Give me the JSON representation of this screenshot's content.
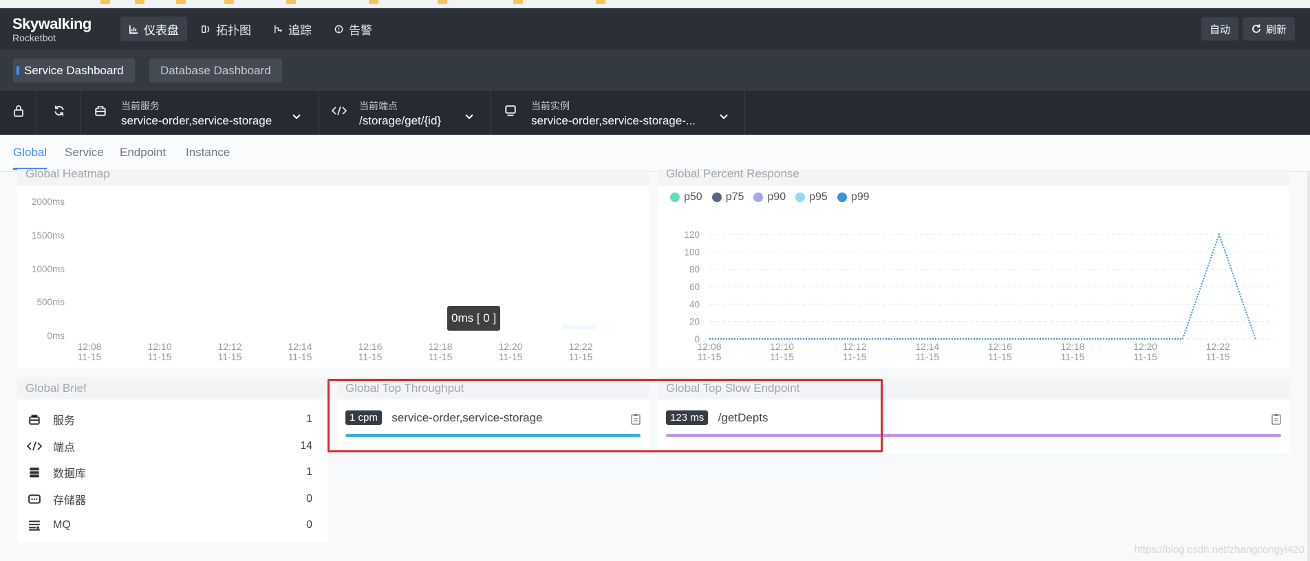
{
  "app": {
    "brand": "Skywalking",
    "sub": "Rocketbot"
  },
  "nav": {
    "items": [
      {
        "label": "仪表盘",
        "icon": "chart-icon"
      },
      {
        "label": "拓扑图",
        "icon": "topology-icon"
      },
      {
        "label": "追踪",
        "icon": "trace-icon"
      },
      {
        "label": "告警",
        "icon": "alarm-icon"
      }
    ],
    "auto_label": "自动",
    "refresh_label": "刷新"
  },
  "dashboards": {
    "active": "Service Dashboard",
    "inactive": "Database Dashboard"
  },
  "selectors": {
    "service": {
      "label": "当前服务",
      "value": "service-order,service-storage"
    },
    "endpoint": {
      "label": "当前端点",
      "value": "/storage/get/{id}"
    },
    "instance": {
      "label": "当前实例",
      "value": "service-order,service-storage-..."
    }
  },
  "tabs": [
    "Global",
    "Service",
    "Endpoint",
    "Instance"
  ],
  "heatmap": {
    "title": "Global Heatmap",
    "y_ticks": [
      "2000ms",
      "1500ms",
      "1000ms",
      "500ms",
      "0ms"
    ],
    "x_ticks": [
      "12:08",
      "12:10",
      "12:12",
      "12:14",
      "12:16",
      "12:18",
      "12:20",
      "12:22"
    ],
    "date": "11-15",
    "tooltip": "0ms [ 0 ]"
  },
  "percent": {
    "title": "Global Percent Response",
    "legend": [
      {
        "name": "p50",
        "color": "#5fe0b9"
      },
      {
        "name": "p75",
        "color": "#5a6683"
      },
      {
        "name": "p90",
        "color": "#a3a9e6"
      },
      {
        "name": "p95",
        "color": "#90dcec"
      },
      {
        "name": "p99",
        "color": "#3d8fe0"
      }
    ]
  },
  "chart_data": {
    "type": "line",
    "title": "Global Percent Response",
    "x": [
      "12:08",
      "12:10",
      "12:12",
      "12:14",
      "12:16",
      "12:18",
      "12:20",
      "12:22"
    ],
    "x_sub": "11-15",
    "ylim": [
      0,
      120
    ],
    "y_ticks": [
      0,
      20,
      40,
      60,
      80,
      100,
      120
    ],
    "series": [
      {
        "name": "p99",
        "color": "#3d8fe0",
        "points": [
          [
            0,
            0
          ],
          [
            13,
            0
          ],
          [
            14,
            120
          ],
          [
            15,
            0
          ]
        ]
      }
    ]
  },
  "brief": {
    "title": "Global Brief",
    "rows": [
      {
        "label": "服务",
        "value": "1",
        "icon": "service-icon"
      },
      {
        "label": "端点",
        "value": "14",
        "icon": "endpoint-icon"
      },
      {
        "label": "数据库",
        "value": "1",
        "icon": "database-icon"
      },
      {
        "label": "存储器",
        "value": "0",
        "icon": "storage-icon"
      },
      {
        "label": "MQ",
        "value": "0",
        "icon": "mq-icon"
      }
    ]
  },
  "throughput": {
    "title": "Global Top Throughput",
    "items": [
      {
        "badge": "1 cpm",
        "label": "service-order,service-storage",
        "color": "#3aafe3"
      }
    ]
  },
  "slow": {
    "title": "Global Top Slow Endpoint",
    "items": [
      {
        "badge": "123 ms",
        "label": "/getDepts",
        "color": "#c39ae8"
      }
    ]
  },
  "watermark": "https://blog.csdn.net/zhangcongyi420"
}
